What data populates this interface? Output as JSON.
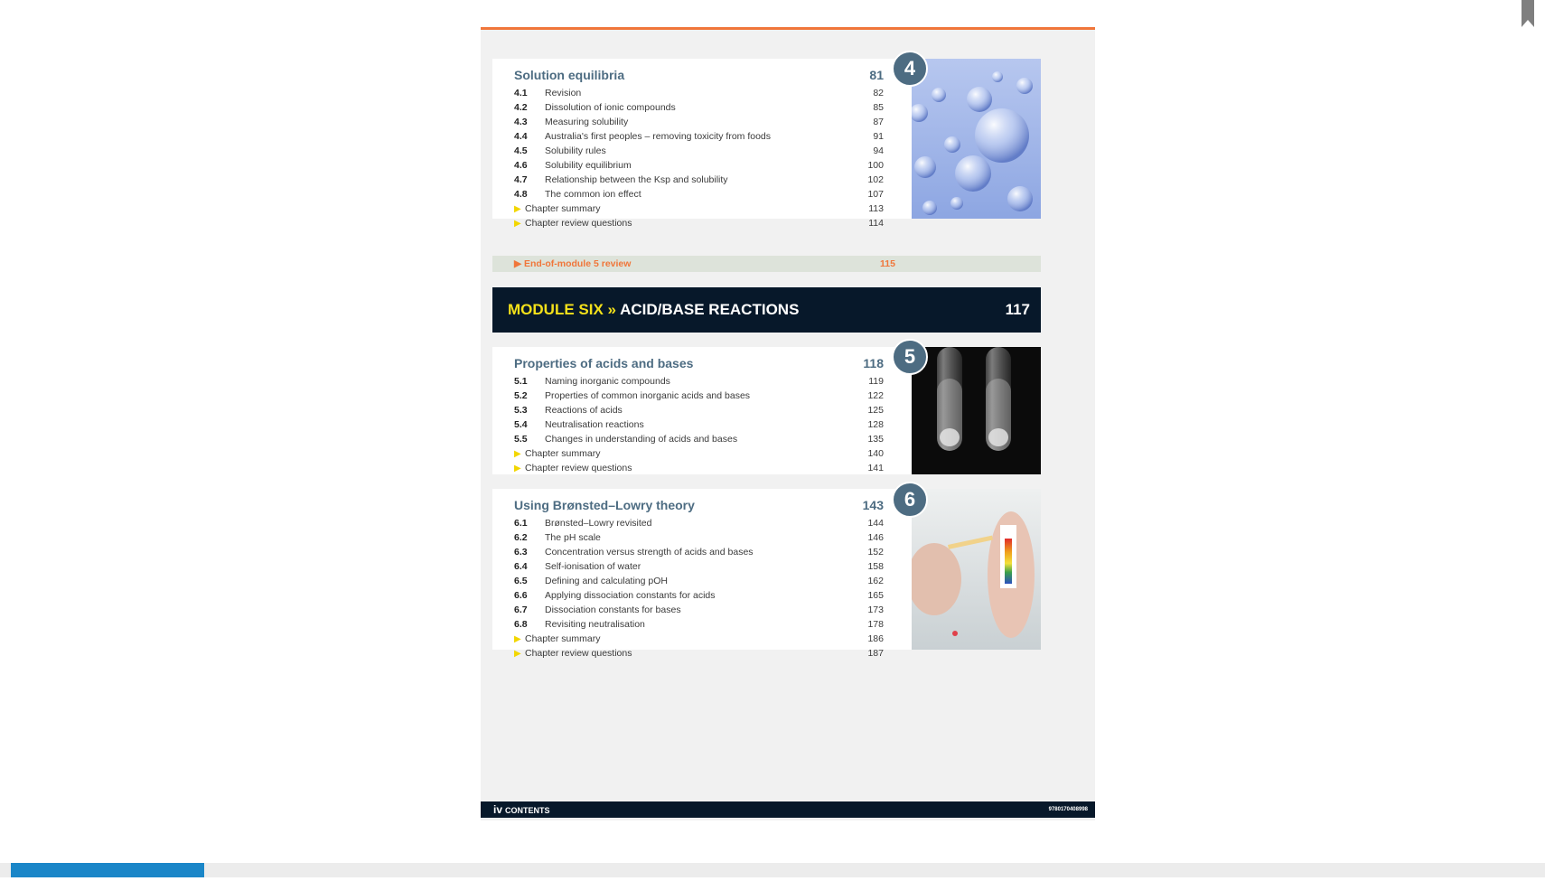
{
  "colors": {
    "accent_orange": "#f0763a",
    "chapter_blue": "#4d6c82",
    "module_yellow": "#f4e11a",
    "module_bg": "#07182a",
    "progress_blue": "#1a86c8"
  },
  "chapters": [
    {
      "number": "4",
      "title": "Solution equilibria",
      "page": "81",
      "image_icon": "bubbles-photo",
      "sections": [
        {
          "num": "4.1",
          "title": "Revision",
          "page": "82"
        },
        {
          "num": "4.2",
          "title": "Dissolution of ionic compounds",
          "page": "85"
        },
        {
          "num": "4.3",
          "title": "Measuring solubility",
          "page": "87"
        },
        {
          "num": "4.4",
          "title": "Australia's first peoples – removing toxicity from foods",
          "page": "91"
        },
        {
          "num": "4.5",
          "title": "Solubility rules",
          "page": "94"
        },
        {
          "num": "4.6",
          "title": "Solubility equilibrium",
          "page": "100"
        },
        {
          "num": "4.7",
          "title": "Relationship between the Ksp and solubility",
          "page": "102"
        },
        {
          "num": "4.8",
          "title": "The common ion effect",
          "page": "107"
        }
      ],
      "extras": [
        {
          "title": "Chapter summary",
          "page": "113"
        },
        {
          "title": "Chapter review questions",
          "page": "114"
        }
      ]
    },
    {
      "number": "5",
      "title": "Properties of acids and bases",
      "page": "118",
      "image_icon": "test-tubes-photo",
      "sections": [
        {
          "num": "5.1",
          "title": "Naming inorganic compounds",
          "page": "119"
        },
        {
          "num": "5.2",
          "title": "Properties of common inorganic acids and bases",
          "page": "122"
        },
        {
          "num": "5.3",
          "title": "Reactions of acids",
          "page": "125"
        },
        {
          "num": "5.4",
          "title": "Neutralisation reactions",
          "page": "128"
        },
        {
          "num": "5.5",
          "title": "Changes in understanding of acids and bases",
          "page": "135"
        }
      ],
      "extras": [
        {
          "title": "Chapter summary",
          "page": "140"
        },
        {
          "title": "Chapter review questions",
          "page": "141"
        }
      ]
    },
    {
      "number": "6",
      "title": "Using Brønsted–Lowry theory",
      "page": "143",
      "image_icon": "ph-strip-photo",
      "sections": [
        {
          "num": "6.1",
          "title": "Brønsted–Lowry revisited",
          "page": "144"
        },
        {
          "num": "6.2",
          "title": "The pH scale",
          "page": "146"
        },
        {
          "num": "6.3",
          "title": "Concentration versus strength of acids and bases",
          "page": "152"
        },
        {
          "num": "6.4",
          "title": "Self-ionisation of water",
          "page": "158"
        },
        {
          "num": "6.5",
          "title": "Defining and calculating pOH",
          "page": "162"
        },
        {
          "num": "6.6",
          "title": "Applying dissociation constants for acids",
          "page": "165"
        },
        {
          "num": "6.7",
          "title": "Dissociation constants for bases",
          "page": "173"
        },
        {
          "num": "6.8",
          "title": "Revisiting neutralisation",
          "page": "178"
        }
      ],
      "extras": [
        {
          "title": "Chapter summary",
          "page": "186"
        },
        {
          "title": "Chapter review questions",
          "page": "187"
        }
      ]
    }
  ],
  "end_of_module": {
    "label": "▶ End-of-module 5 review",
    "page": "115"
  },
  "module": {
    "prefix": "MODULE SIX »",
    "title": "ACID/BASE REACTIONS",
    "page": "117"
  },
  "footer": {
    "page_num": "iv",
    "label": "CONTENTS",
    "isbn": "9780170408998"
  },
  "progress_fraction": 0.125
}
